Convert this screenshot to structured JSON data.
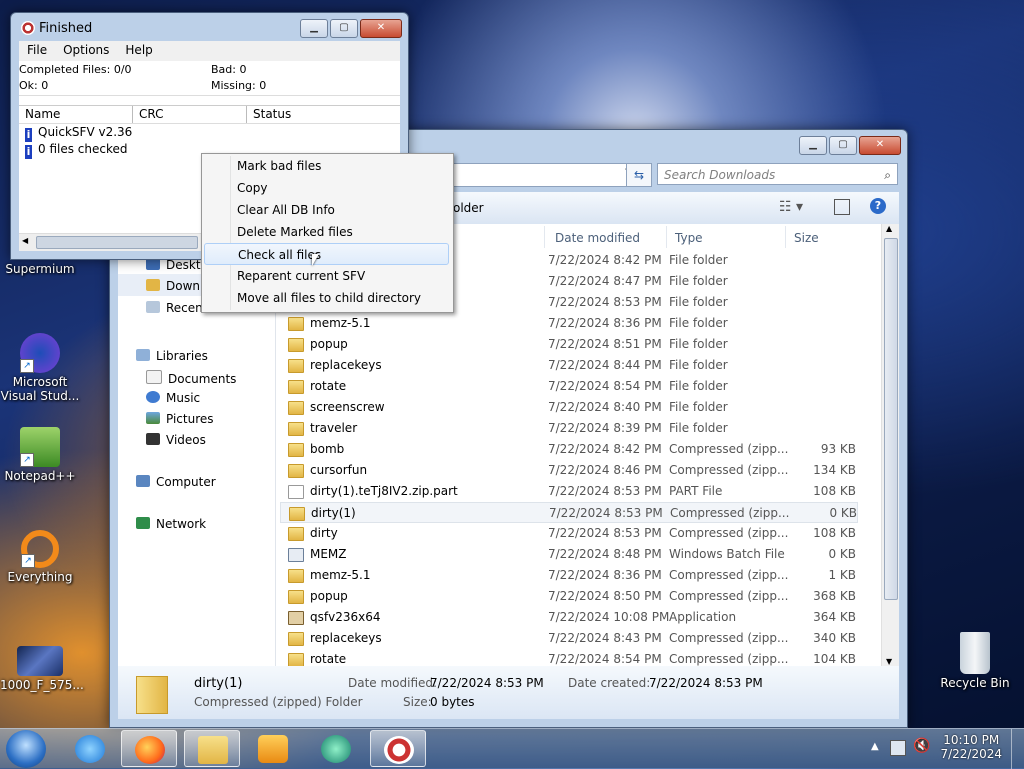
{
  "desktop": {
    "icons": [
      {
        "label": "Supermium"
      },
      {
        "label": "Microsoft Visual Stud..."
      },
      {
        "label": "Notepad++"
      },
      {
        "label": "Everything"
      },
      {
        "label": "1000_F_575..."
      },
      {
        "label": "Recycle Bin"
      }
    ]
  },
  "qsfv": {
    "title": "Finished",
    "menu": [
      "File",
      "Options",
      "Help"
    ],
    "completed": "Completed Files: 0/0",
    "bad": "Bad: 0",
    "ok": "Ok: 0",
    "missing": "Missing: 0",
    "columns": [
      "Name",
      "CRC",
      "Status"
    ],
    "messages": [
      "QuickSFV v2.36",
      "0 files checked"
    ]
  },
  "context_menu": {
    "items": [
      "Mark bad files",
      "Copy",
      "Clear All DB Info",
      "Delete Marked files",
      "Check all files",
      "Reparent current SFV",
      "Move all files to child directory"
    ],
    "highlighted_index": 4
  },
  "explorer": {
    "search_placeholder": "Search Downloads",
    "toolbar_folder_fragment": "older",
    "nav": {
      "desktop": "Desktop",
      "downloads": "Downloads",
      "recent": "Recent",
      "libraries": "Libraries",
      "documents": "Documents",
      "music": "Music",
      "pictures": "Pictures",
      "videos": "Videos",
      "computer": "Computer",
      "network": "Network"
    },
    "columns": {
      "date": "Date modified",
      "type": "Type",
      "size": "Size"
    },
    "rows": [
      {
        "name": "",
        "date": "7/22/2024 8:42 PM",
        "type": "File folder",
        "size": "",
        "icon": "folder"
      },
      {
        "name": "",
        "date": "7/22/2024 8:47 PM",
        "type": "File folder",
        "size": "",
        "icon": "folder"
      },
      {
        "name": "",
        "date": "7/22/2024 8:53 PM",
        "type": "File folder",
        "size": "",
        "icon": "folder"
      },
      {
        "name": "memz-5.1",
        "date": "7/22/2024 8:36 PM",
        "type": "File folder",
        "size": "",
        "icon": "folder"
      },
      {
        "name": "popup",
        "date": "7/22/2024 8:51 PM",
        "type": "File folder",
        "size": "",
        "icon": "folder"
      },
      {
        "name": "replacekeys",
        "date": "7/22/2024 8:44 PM",
        "type": "File folder",
        "size": "",
        "icon": "folder"
      },
      {
        "name": "rotate",
        "date": "7/22/2024 8:54 PM",
        "type": "File folder",
        "size": "",
        "icon": "folder"
      },
      {
        "name": "screenscrew",
        "date": "7/22/2024 8:40 PM",
        "type": "File folder",
        "size": "",
        "icon": "folder"
      },
      {
        "name": "traveler",
        "date": "7/22/2024 8:39 PM",
        "type": "File folder",
        "size": "",
        "icon": "folder"
      },
      {
        "name": "bomb",
        "date": "7/22/2024 8:42 PM",
        "type": "Compressed (zipp...",
        "size": "93 KB",
        "icon": "zip"
      },
      {
        "name": "cursorfun",
        "date": "7/22/2024 8:46 PM",
        "type": "Compressed (zipp...",
        "size": "134 KB",
        "icon": "zip"
      },
      {
        "name": "dirty(1).teTj8IV2.zip.part",
        "date": "7/22/2024 8:53 PM",
        "type": "PART File",
        "size": "108 KB",
        "icon": "file"
      },
      {
        "name": "dirty(1)",
        "date": "7/22/2024 8:53 PM",
        "type": "Compressed (zipp...",
        "size": "0 KB",
        "icon": "zip"
      },
      {
        "name": "dirty",
        "date": "7/22/2024 8:53 PM",
        "type": "Compressed (zipp...",
        "size": "108 KB",
        "icon": "zip"
      },
      {
        "name": "MEMZ",
        "date": "7/22/2024 8:48 PM",
        "type": "Windows Batch File",
        "size": "0 KB",
        "icon": "bat"
      },
      {
        "name": "memz-5.1",
        "date": "7/22/2024 8:36 PM",
        "type": "Compressed (zipp...",
        "size": "1 KB",
        "icon": "zip"
      },
      {
        "name": "popup",
        "date": "7/22/2024 8:50 PM",
        "type": "Compressed (zipp...",
        "size": "368 KB",
        "icon": "zip"
      },
      {
        "name": "qsfv236x64",
        "date": "7/22/2024 10:08 PM",
        "type": "Application",
        "size": "364 KB",
        "icon": "app"
      },
      {
        "name": "replacekeys",
        "date": "7/22/2024 8:43 PM",
        "type": "Compressed (zipp...",
        "size": "340 KB",
        "icon": "zip"
      },
      {
        "name": "rotate",
        "date": "7/22/2024 8:54 PM",
        "type": "Compressed (zipp...",
        "size": "104 KB",
        "icon": "zip"
      }
    ],
    "selected_index": 12,
    "details": {
      "name": "dirty(1)",
      "kind": "Compressed (zipped) Folder",
      "date_modified_label": "Date modified:",
      "date_modified": "7/22/2024 8:53 PM",
      "date_created_label": "Date created:",
      "date_created": "7/22/2024 8:53 PM",
      "size_label": "Size:",
      "size": "0 bytes"
    }
  },
  "taskbar": {
    "time": "10:10 PM",
    "date": "7/22/2024"
  },
  "colors": {
    "accent_folder": "#e2b545",
    "menu_highlight": "#dfecfb"
  }
}
